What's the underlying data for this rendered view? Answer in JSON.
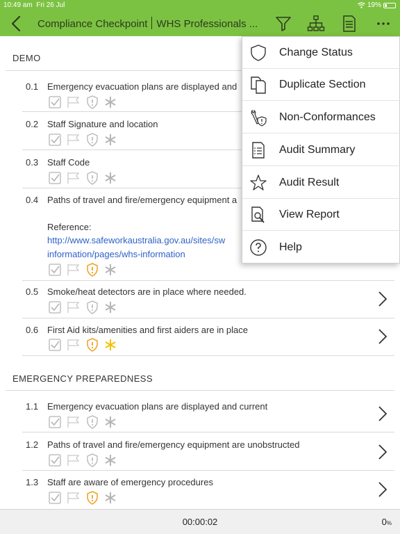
{
  "status_bar": {
    "time": "10:49 am",
    "date": "Fri 26 Jul",
    "battery": "19%"
  },
  "navbar": {
    "title": "Compliance Checkpoint",
    "subtitle": "WHS Professionals ...",
    "icons": [
      "back-icon",
      "filter-icon",
      "hierarchy-icon",
      "report-icon",
      "more-icon"
    ]
  },
  "sections": [
    {
      "heading": "DEMO",
      "items": [
        {
          "number": "0.1",
          "text": "Emergency evacuation plans are displayed and",
          "alert": "grey",
          "star": "grey"
        },
        {
          "number": "0.2",
          "text": "Staff Signature and location",
          "alert": "grey",
          "star": "grey"
        },
        {
          "number": "0.3",
          "text": "Staff Code",
          "alert": "grey",
          "star": "grey"
        },
        {
          "number": "0.4",
          "text": "Paths of travel and fire/emergency equipment a",
          "reference_label": "Reference:",
          "reference_line1": "http://www.safeworkaustralia.gov.au/sites/sw",
          "reference_line2": "information/pages/whs-information",
          "alert": "orange",
          "star": "grey"
        },
        {
          "number": "0.5",
          "text": "Smoke/heat detectors are in place where needed.",
          "alert": "grey",
          "star": "grey"
        },
        {
          "number": "0.6",
          "text": "First Aid kits/amenities and first aiders are in place",
          "alert": "orange",
          "star": "yellow"
        }
      ]
    },
    {
      "heading": "EMERGENCY PREPAREDNESS",
      "items": [
        {
          "number": "1.1",
          "text": "Emergency evacuation plans are displayed and current",
          "alert": "grey",
          "star": "grey"
        },
        {
          "number": "1.2",
          "text": "Paths of travel and fire/emergency equipment are unobstructed",
          "alert": "grey",
          "star": "grey"
        },
        {
          "number": "1.3",
          "text": "Staff are aware of emergency procedures",
          "alert": "orange",
          "star": "grey"
        }
      ]
    }
  ],
  "menu": {
    "items": [
      {
        "label": "Change Status",
        "icon": "shield-icon"
      },
      {
        "label": "Duplicate Section",
        "icon": "duplicate-icon"
      },
      {
        "label": "Non-Conformances",
        "icon": "tools-alert-icon"
      },
      {
        "label": "Audit Summary",
        "icon": "document-list-icon"
      },
      {
        "label": "Audit Result",
        "icon": "star-icon"
      },
      {
        "label": "View Report",
        "icon": "report-search-icon"
      },
      {
        "label": "Help",
        "icon": "help-icon"
      }
    ]
  },
  "bottom_bar": {
    "timer": "00:00:02",
    "percent": "0",
    "percent_sign": "%"
  },
  "colors": {
    "accent": "#7cc242",
    "alert_orange": "#f0a020",
    "star_yellow": "#f2c200",
    "inactive_grey": "#b5b5b5",
    "link": "#2f62c9"
  }
}
